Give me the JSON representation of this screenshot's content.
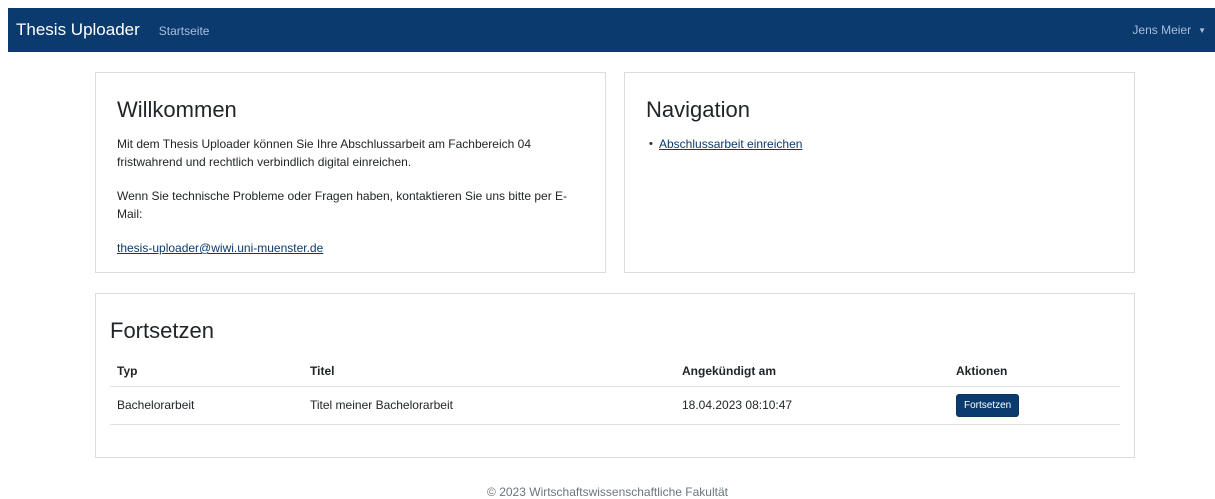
{
  "navbar": {
    "brand": "Thesis Uploader",
    "home_link": "Startseite",
    "user_name": "Jens Meier",
    "user_caret": "▼",
    "background": "#0b3a6e"
  },
  "welcome": {
    "title": "Willkommen",
    "paragraph1": "Mit dem Thesis Uploader können Sie Ihre Abschlussarbeit am Fachbereich 04 fristwahrend und rechtlich verbindlich digital einreichen.",
    "paragraph2": "Wenn Sie technische Probleme oder Fragen haben, kontaktieren Sie uns bitte per E-Mail:",
    "email": "thesis-uploader@wiwi.uni-muenster.de"
  },
  "navigation": {
    "title": "Navigation",
    "items": [
      {
        "label": "Abschlussarbeit einreichen"
      }
    ]
  },
  "continue": {
    "title": "Fortsetzen",
    "columns": [
      "Typ",
      "Titel",
      "Angekündigt am",
      "Aktionen"
    ],
    "rows": [
      {
        "typ": "Bachelorarbeit",
        "titel": "Titel meiner Bachelorarbeit",
        "datum": "18.04.2023 08:10:47",
        "action_label": "Fortsetzen"
      }
    ]
  },
  "footer": {
    "text": "© 2023 Wirtschaftswissenschaftliche Fakultät"
  }
}
